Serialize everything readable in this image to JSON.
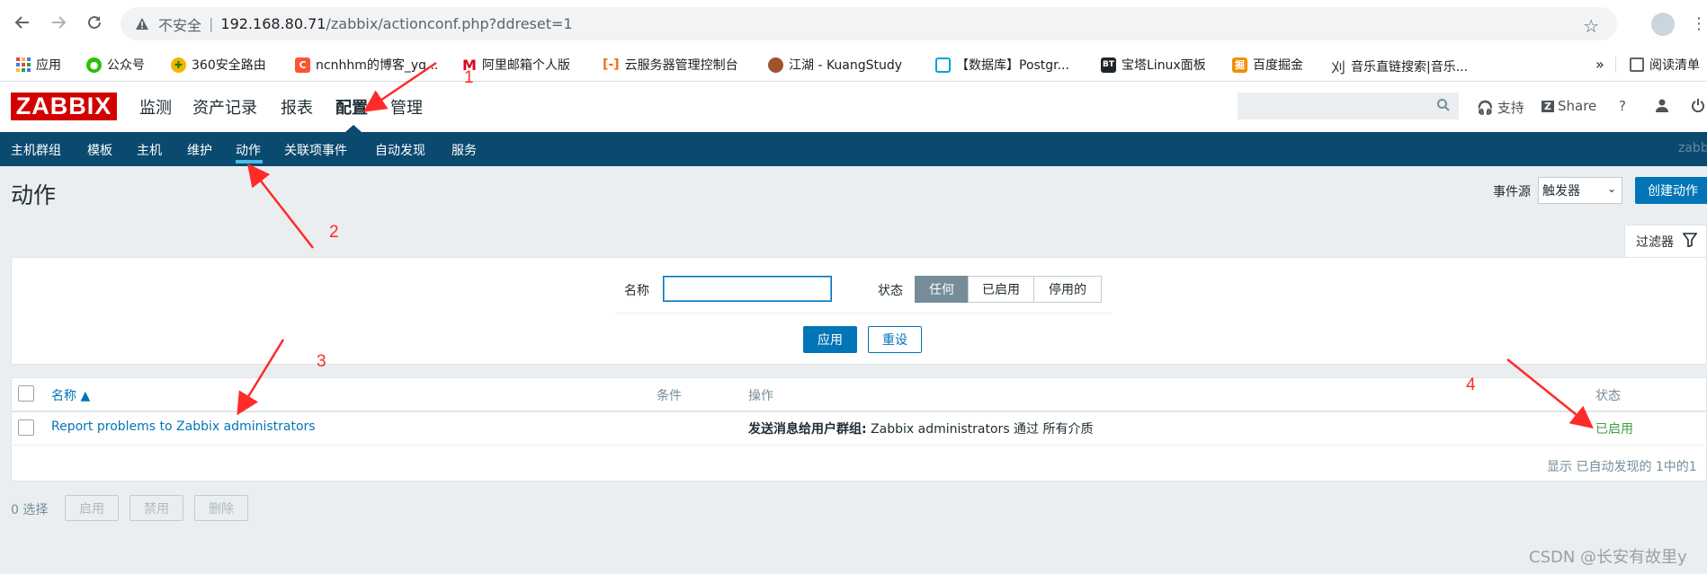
{
  "browser": {
    "insecure_label": "不安全",
    "url_host": "192.168.80.71",
    "url_path": "/zabbix/actionconf.php?ddreset=1",
    "reading_list": "阅读清单"
  },
  "bookmarks": [
    {
      "label": "应用",
      "icon": "apps-grid-icon",
      "color": "#e8453c"
    },
    {
      "label": "公众号",
      "icon": "wechat-icon",
      "color": "#2dc100"
    },
    {
      "label": "360安全路由",
      "icon": "360-icon",
      "color": "#f6b400"
    },
    {
      "label": "ncnhhm的博客_yq...",
      "icon": "csdn-c-icon",
      "color": "#fc5531"
    },
    {
      "label": "阿里邮箱个人版",
      "icon": "aliyun-mail-icon",
      "color": "#e0001b"
    },
    {
      "label": "云服务器管理控制台",
      "icon": "aliyun-icon",
      "color": "#ff6a00"
    },
    {
      "label": "江湖 - KuangStudy",
      "icon": "avatar-icon",
      "color": "#a0522d"
    },
    {
      "label": "【数据库】Postgr...",
      "icon": "bilibili-icon",
      "color": "#00a1d6"
    },
    {
      "label": "宝塔Linux面板",
      "icon": "bt-icon",
      "color": "#20252a"
    },
    {
      "label": "百度掘金",
      "icon": "juejin-icon",
      "color": "#f18f01"
    },
    {
      "label": "音乐直链搜索|音乐...",
      "icon": "music-icon",
      "color": "#333333"
    }
  ],
  "header": {
    "logo": "ZABBIX",
    "menu": [
      "监测",
      "资产记录",
      "报表",
      "配置",
      "管理"
    ],
    "support": "支持",
    "share": "Share",
    "help": "?",
    "brand_red": "#d40000"
  },
  "subnav": {
    "items": [
      "主机群组",
      "模板",
      "主机",
      "维护",
      "动作",
      "关联项事件",
      "自动发现",
      "服务"
    ],
    "right_text": "zabb"
  },
  "page": {
    "title": "动作",
    "event_source_label": "事件源",
    "event_source_value": "触发器",
    "create_button": "创建动作"
  },
  "filter": {
    "tab_label": "过滤器",
    "name_label": "名称",
    "name_value": "",
    "status_label": "状态",
    "status_options": [
      "任何",
      "已启用",
      "停用的"
    ],
    "status_selected": "任何",
    "apply": "应用",
    "reset": "重设"
  },
  "table": {
    "headers": {
      "name": "名称 ▲",
      "conditions": "条件",
      "operations": "操作",
      "status": "状态"
    },
    "rows": [
      {
        "name": "Report problems to Zabbix administrators",
        "conditions": "",
        "operations_bold": "发送消息给用户群组:",
        "operations_rest": " Zabbix administrators 通过 所有介质",
        "status": "已启用"
      }
    ],
    "footer": "显示 已自动发现的 1中的1"
  },
  "bulk": {
    "selected": "0 选择",
    "enable": "启用",
    "disable": "禁用",
    "delete": "删除"
  },
  "annotations": [
    "1",
    "2",
    "3",
    "4"
  ],
  "watermark": "CSDN @长安有故里y"
}
